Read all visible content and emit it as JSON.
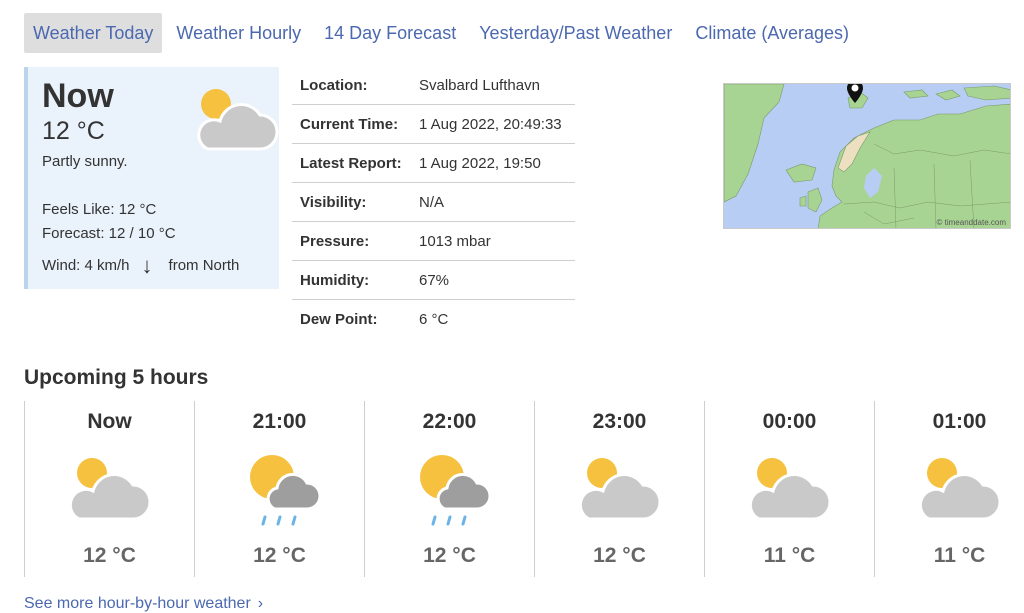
{
  "tabs": [
    {
      "label": "Weather Today",
      "active": true
    },
    {
      "label": "Weather Hourly"
    },
    {
      "label": "14 Day Forecast"
    },
    {
      "label": "Yesterday/Past Weather"
    },
    {
      "label": "Climate (Averages)"
    }
  ],
  "now": {
    "title": "Now",
    "temp": "12 °C",
    "desc": "Partly sunny.",
    "feels_like": "Feels Like: 12 °C",
    "forecast": "Forecast: 12 / 10 °C",
    "wind": "Wind: 4 km/h",
    "wind_dir": "from North",
    "icon": "partly-sunny-icon"
  },
  "details": [
    {
      "label": "Location:",
      "value": "Svalbard Lufthavn"
    },
    {
      "label": "Current Time:",
      "value": "1 Aug 2022, 20:49:33"
    },
    {
      "label": "Latest Report:",
      "value": "1 Aug 2022, 19:50"
    },
    {
      "label": "Visibility:",
      "value": "N/A"
    },
    {
      "label": "Pressure:",
      "value": "1013 mbar"
    },
    {
      "label": "Humidity:",
      "value": "67%"
    },
    {
      "label": "Dew Point:",
      "value": "6 °C"
    }
  ],
  "map": {
    "credit": "© timeanddate.com"
  },
  "upcoming": {
    "title": "Upcoming 5 hours",
    "hours": [
      {
        "time": "Now",
        "temp": "12 °C",
        "icon": "partly-sunny-icon"
      },
      {
        "time": "21:00",
        "temp": "12 °C",
        "icon": "sun-rain-icon"
      },
      {
        "time": "22:00",
        "temp": "12 °C",
        "icon": "sun-rain-icon"
      },
      {
        "time": "23:00",
        "temp": "12 °C",
        "icon": "partly-sunny-icon"
      },
      {
        "time": "00:00",
        "temp": "11 °C",
        "icon": "partly-sunny-icon"
      },
      {
        "time": "01:00",
        "temp": "11 °C",
        "icon": "partly-sunny-icon"
      }
    ]
  },
  "more_link": "See more hour-by-hour weather",
  "colors": {
    "link": "#4b68b0",
    "sun": "#f5c13e",
    "cloud": "#c9c9c9",
    "rain": "#6cb3e8",
    "card_bg": "#eaf2fb"
  }
}
